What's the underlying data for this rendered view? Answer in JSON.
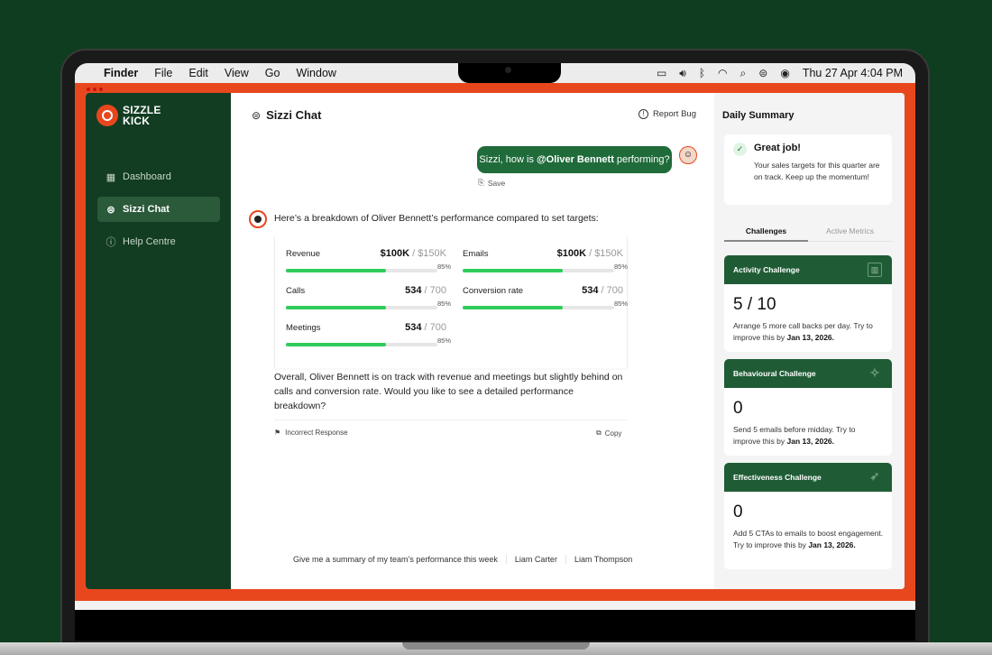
{
  "menubar": {
    "app": "Finder",
    "menus": [
      "File",
      "Edit",
      "View",
      "Go",
      "Window"
    ],
    "datetime": "Thu 27 Apr  4:04 PM"
  },
  "brand": {
    "line1": "SIZZLE",
    "line2": "KICK",
    "color": "#e8471e"
  },
  "sidebar": {
    "items": [
      {
        "label": "Dashboard",
        "icon": "grid-icon"
      },
      {
        "label": "Sizzi Chat",
        "icon": "chat-icon",
        "active": true
      },
      {
        "label": "Help Centre",
        "icon": "help-icon"
      }
    ]
  },
  "chat": {
    "title": "Sizzi Chat",
    "report_bug": "Report Bug",
    "user_message": {
      "prefix": "Sizzi, how is",
      "mention": "@Oliver Bennett",
      "suffix": "performing?"
    },
    "save_label": "Save",
    "bot_intro": "Here’s a breakdown of Oliver Bennett’s performance compared to set targets:",
    "metrics": [
      {
        "label": "Revenue",
        "value": "$100K",
        "target": "/ $150K",
        "percent": "85%",
        "fill": 0.66
      },
      {
        "label": "Emails",
        "value": "$100K",
        "target": "/ $150K",
        "percent": "85%",
        "fill": 0.66
      },
      {
        "label": "Calls",
        "value": "534",
        "target": "/ 700",
        "percent": "85%",
        "fill": 0.66
      },
      {
        "label": "Conversion rate",
        "value": "534",
        "target": "/ 700",
        "percent": "85%",
        "fill": 0.66
      },
      {
        "label": "Meetings",
        "value": "534",
        "target": "/ 700",
        "percent": "85%",
        "fill": 0.66
      }
    ],
    "summary": "Overall, Oliver Bennett is on track with revenue and meetings but slightly behind on calls and conversion rate. Would you like to see a detailed performance breakdown?",
    "incorrect_label": "Incorrect Response",
    "copy_label": "Copy",
    "suggestions": [
      "Give me a summary of my team’s performance this week",
      "Liam Carter",
      "Liam Thompson"
    ]
  },
  "daily_summary": {
    "title": "Daily Summary",
    "great_title": "Great job!",
    "great_text": "Your sales targets for this quarter are on track. Keep up the momentum!",
    "tabs": [
      "Challenges",
      "Active Metrics"
    ],
    "cards": [
      {
        "title": "Activity Challenge",
        "icon": "bar-chart-icon",
        "value": "5 / 10",
        "text": "Arrange 5 more call backs per day. Try to improve this by",
        "date": "Jan 13, 2026."
      },
      {
        "title": "Behavioural Challenge",
        "icon": "sparkle-icon",
        "value": "0",
        "text": "Send 5 emails before midday. Try to improve this by",
        "date": "Jan 13, 2026."
      },
      {
        "title": "Effectiveness Challenge",
        "icon": "rocket-icon",
        "value": "0",
        "text": "Add 5 CTAs to emails to boost engagement. Try to improve this by",
        "date": "Jan 13, 2026."
      }
    ]
  }
}
